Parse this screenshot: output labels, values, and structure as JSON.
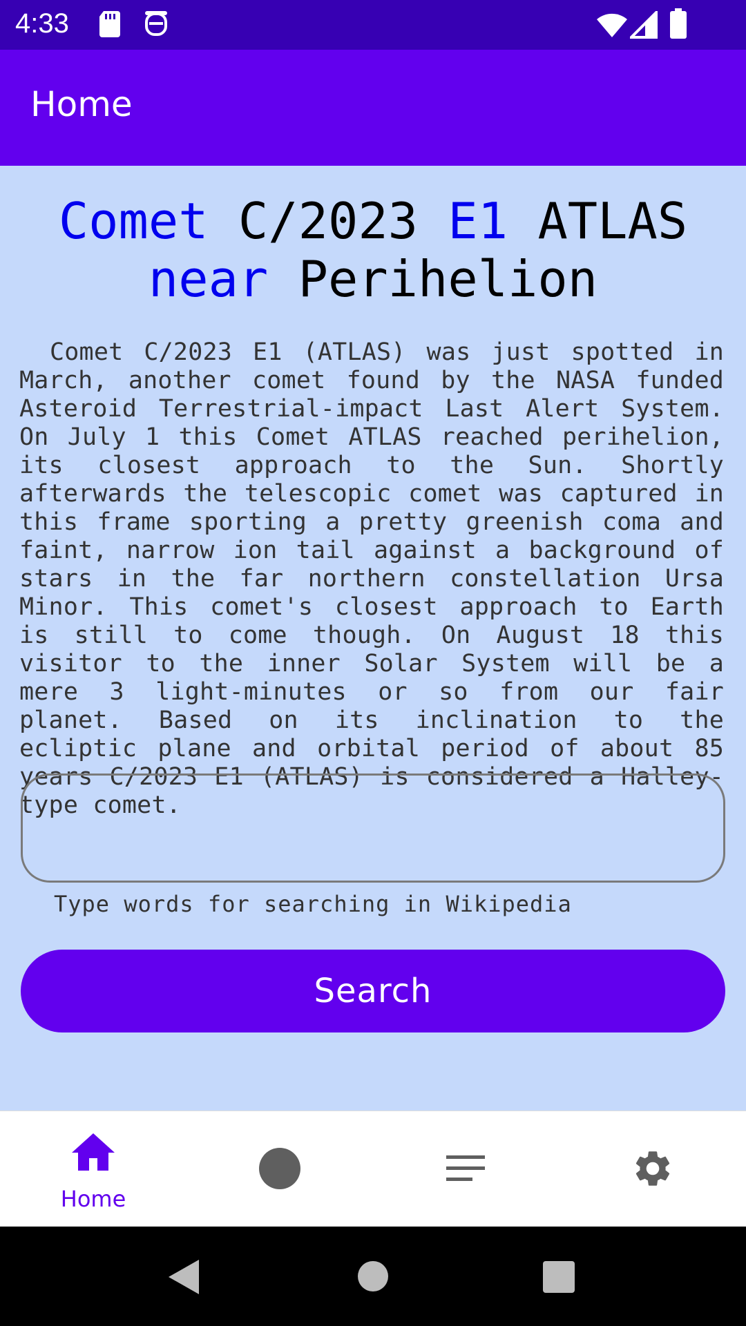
{
  "status_bar": {
    "time": "4:33",
    "icons": [
      "sd-card-icon",
      "face-icon",
      "wifi-icon",
      "cell-signal-icon",
      "battery-icon"
    ]
  },
  "app_bar": {
    "title": "Home"
  },
  "headline": {
    "parts": [
      {
        "text": "Comet",
        "color": "#0000ee"
      },
      {
        "text": "C/2023",
        "color": "#000000"
      },
      {
        "text": "E1",
        "color": "#0000ee"
      },
      {
        "text": "ATLAS",
        "color": "#000000"
      },
      {
        "text": "near",
        "color": "#0000ee"
      },
      {
        "text": "Perihelion",
        "color": "#000000"
      }
    ]
  },
  "article": {
    "body": "Comet C/2023 E1 (ATLAS) was just spotted in March, another comet found by the NASA funded Asteroid Terrestrial-impact Last Alert System. On July 1 this Comet ATLAS reached perihelion, its closest approach to the Sun. Shortly afterwards the telescopic comet was captured in this frame sporting a pretty greenish coma and faint, narrow ion tail against a background of stars in the far northern constellation Ursa Minor. This comet's closest approach to Earth is still to come though. On August 18 this visitor to the inner Solar System will be a mere 3 light-minutes or so from our fair planet. Based on its inclination to the ecliptic plane and orbital period of about 85 years C/2023 E1 (ATLAS) is considered a Halley-type comet."
  },
  "search": {
    "value": "",
    "helper": "Type words for searching in Wikipedia",
    "button_label": "Search"
  },
  "bottom_nav": {
    "items": [
      {
        "label": "Home",
        "icon": "home-icon",
        "active": true
      },
      {
        "label": "",
        "icon": "circle-icon",
        "active": false
      },
      {
        "label": "",
        "icon": "menu-icon",
        "active": false
      },
      {
        "label": "",
        "icon": "gear-icon",
        "active": false
      }
    ]
  },
  "system_nav": {
    "icons": [
      "back-icon",
      "home-circle-icon",
      "recents-icon"
    ]
  },
  "colors": {
    "primary": "#6200ee",
    "primary_dark": "#3700b3",
    "background": "#c5d9fb",
    "accent_text": "#0000ee"
  }
}
